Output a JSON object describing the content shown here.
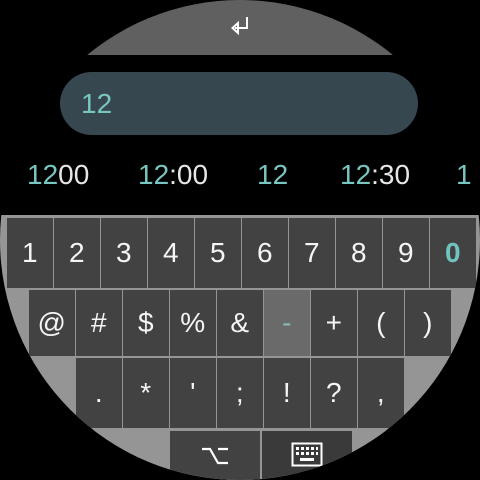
{
  "input": {
    "value": "12"
  },
  "suggestions": [
    {
      "typed": "12",
      "rest": "00"
    },
    {
      "typed": "12",
      "rest": ":00"
    },
    {
      "typed": "12",
      "rest": ""
    },
    {
      "typed": "12",
      "rest": ":30"
    },
    {
      "typed": "1",
      "rest": ""
    }
  ],
  "keyboard": {
    "row1": [
      "1",
      "2",
      "3",
      "4",
      "5",
      "6",
      "7",
      "8",
      "9",
      "0"
    ],
    "row2": [
      "@",
      "#",
      "$",
      "%",
      "&",
      "-",
      "+",
      "(",
      ")"
    ],
    "row3": [
      ".",
      "*",
      "'",
      ";",
      "!",
      "?",
      ","
    ],
    "active_key": "0",
    "pressed_key": "-"
  },
  "icons": {
    "enter": "enter-icon",
    "alt": "option-icon",
    "keyboard": "keyboard-icon"
  },
  "colors": {
    "accent": "#78c6c0",
    "key": "#424242",
    "keyboard_bg": "#959595",
    "input_bg": "#37474f"
  }
}
